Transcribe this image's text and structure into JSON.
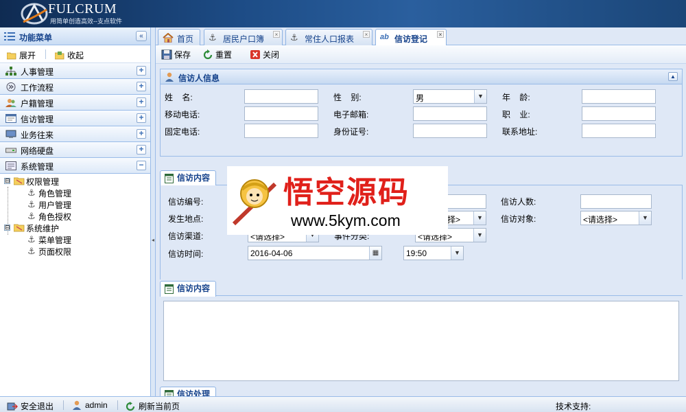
{
  "header": {
    "brand": "FULCRUM",
    "slogan": "用简单创造高效--支点软件"
  },
  "sidebar": {
    "title": "功能菜单",
    "collapse_glyph": "«",
    "expand_label": "展开",
    "collapse_label": "收起",
    "menu": [
      {
        "label": "人事管理",
        "icon": "org-chart-icon",
        "toggle": "+"
      },
      {
        "label": "工作流程",
        "icon": "workflow-icon",
        "toggle": "+"
      },
      {
        "label": "户籍管理",
        "icon": "people-icon",
        "toggle": "+"
      },
      {
        "label": "信访管理",
        "icon": "form-icon",
        "toggle": "+"
      },
      {
        "label": "业务往来",
        "icon": "monitor-icon",
        "toggle": "+"
      },
      {
        "label": "网络硬盘",
        "icon": "drive-icon",
        "toggle": "+"
      },
      {
        "label": "系统管理",
        "icon": "settings-icon",
        "toggle": "−"
      }
    ],
    "tree": {
      "group1": {
        "label": "权限管理",
        "children": [
          "角色管理",
          "用户管理",
          "角色授权"
        ]
      },
      "group2": {
        "label": "系统维护",
        "children": [
          "菜单管理",
          "页面权限"
        ]
      },
      "toggle": "⊟"
    }
  },
  "tabs": [
    {
      "label": "首页",
      "icon": "home-icon",
      "closable": false
    },
    {
      "label": "居民户口簿",
      "icon": "anchor-icon",
      "closable": true
    },
    {
      "label": "常住人口报表",
      "icon": "anchor-icon",
      "closable": true
    },
    {
      "label": "信访登记",
      "icon": "ab-text-icon",
      "closable": true,
      "active": true
    }
  ],
  "tab_icon_text": {
    "ab": "ab",
    "close": "×"
  },
  "toolbar": {
    "save": "保存",
    "reset": "重置",
    "close": "关闭"
  },
  "petitioner_panel": {
    "title": "信访人信息",
    "fields": {
      "name_label": "姓    名:",
      "gender_label": "性    别:",
      "gender_value": "男",
      "age_label": "年    龄:",
      "mobile_label": "移动电话:",
      "email_label": "电子邮箱:",
      "job_label": "职    业:",
      "phone_label": "固定电话:",
      "idcard_label": "身份证号:",
      "address_label": "联系地址:"
    }
  },
  "visit_panel": {
    "tab_title": "信访内容",
    "fields": {
      "number_label": "信访编号:",
      "count_label": "信访人数:",
      "location_label": "发生地点:",
      "location_select_partial": "择>",
      "target_label": "信访对象:",
      "target_value": "<请选择>",
      "channel_label": "信访渠道:",
      "channel_value": "<请选择>",
      "category_label": "事件分类:",
      "category_value": "<请选择>",
      "time_label": "信访时间:",
      "date_value": "2016-04-06",
      "time_value": "19:50"
    }
  },
  "content_panel": {
    "tab_title": "信访内容"
  },
  "handling_panel": {
    "tab_title": "信访处理"
  },
  "watermark": {
    "title": "悟空源码",
    "url": "www.5kym.com"
  },
  "footer": {
    "logout": "安全退出",
    "user": "admin",
    "refresh": "刷新当前页",
    "support": "技术支持:"
  },
  "colors": {
    "header_bg": "#1d4c86",
    "panel_title": "#15428b",
    "watermark_red": "#e0201a"
  }
}
